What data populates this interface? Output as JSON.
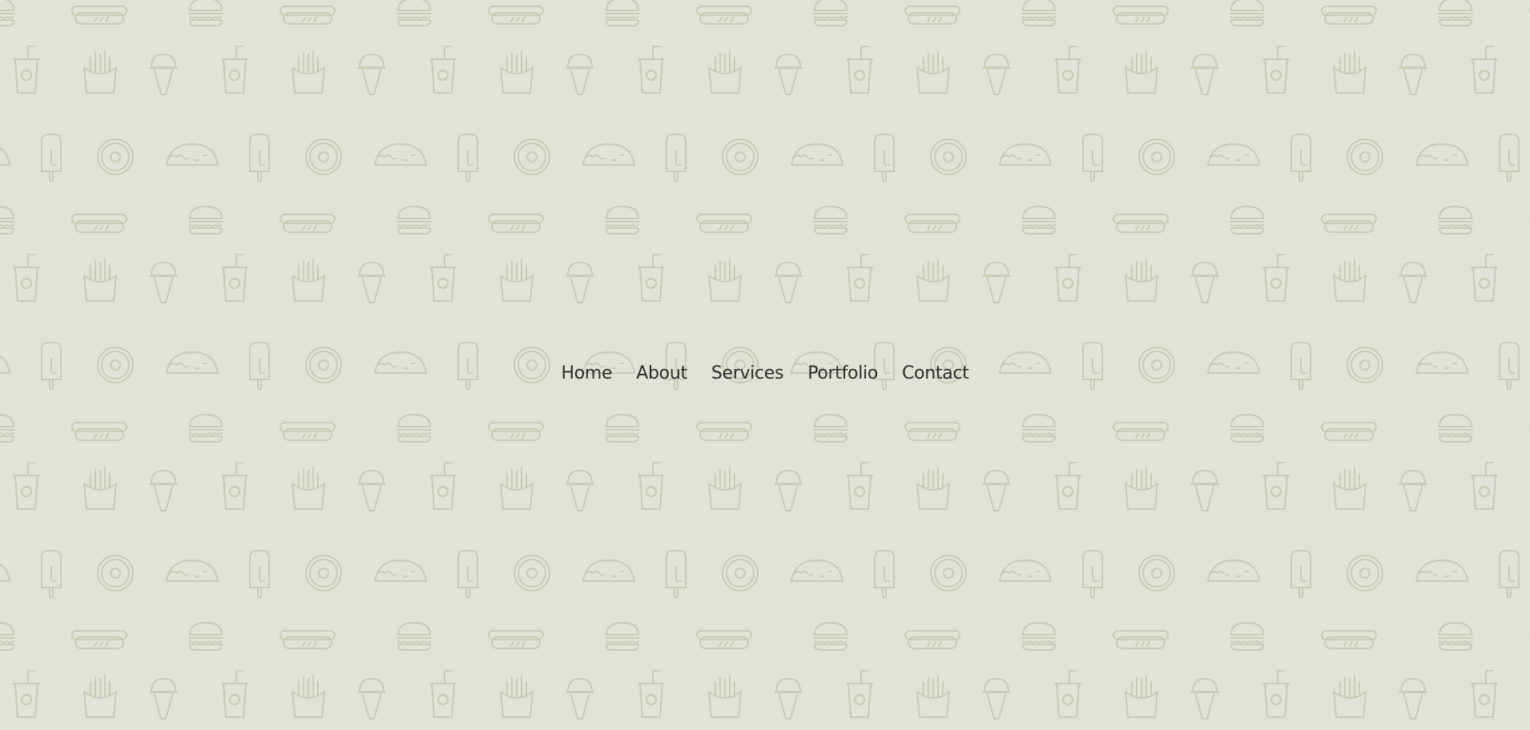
{
  "page": {
    "background_color": "#e1e3d8",
    "pattern_color": "#c9cbb8",
    "pattern_icons": [
      "hotdog-icon",
      "burger-icon",
      "soda-cup-icon",
      "fries-icon",
      "ice-cream-cone-icon",
      "popsicle-icon",
      "donut-icon",
      "taco-icon"
    ]
  },
  "nav": {
    "items": [
      {
        "label": "Home"
      },
      {
        "label": "About"
      },
      {
        "label": "Services"
      },
      {
        "label": "Portfolio"
      },
      {
        "label": "Contact"
      }
    ],
    "text_color": "#2b2b2b"
  }
}
